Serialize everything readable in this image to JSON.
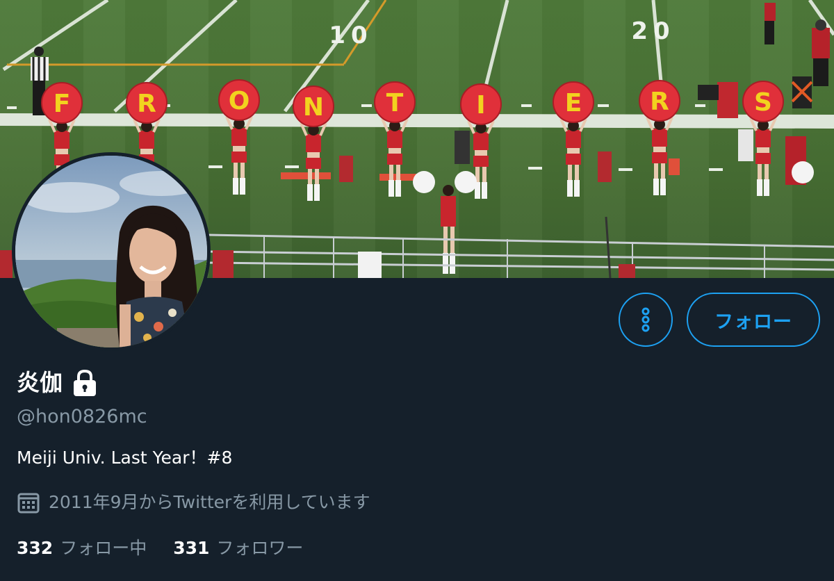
{
  "banner": {
    "yard_numbers": [
      "10",
      "20"
    ],
    "sign_letters": [
      "F",
      "R",
      "O",
      "N",
      "T",
      "I",
      "E",
      "R",
      "S"
    ]
  },
  "profile": {
    "display_name": "炎伽",
    "handle": "@hon0826mc",
    "bio": "Meiji Univ. Last Year！#8",
    "joined": "2011年9月からTwitterを利用しています",
    "protected_icon": "lock-icon",
    "joined_icon": "calendar-icon"
  },
  "actions": {
    "more_icon": "more-vertical-icon",
    "follow_label": "フォロー"
  },
  "stats": {
    "following_count": "332",
    "following_label": "フォロー中",
    "followers_count": "331",
    "followers_label": "フォロワー"
  },
  "colors": {
    "background": "#15202b",
    "accent": "#1da1f2",
    "secondary_text": "#8899a6",
    "text": "#ffffff",
    "sign_red": "#e0303a",
    "sign_letter": "#f2d21f"
  }
}
